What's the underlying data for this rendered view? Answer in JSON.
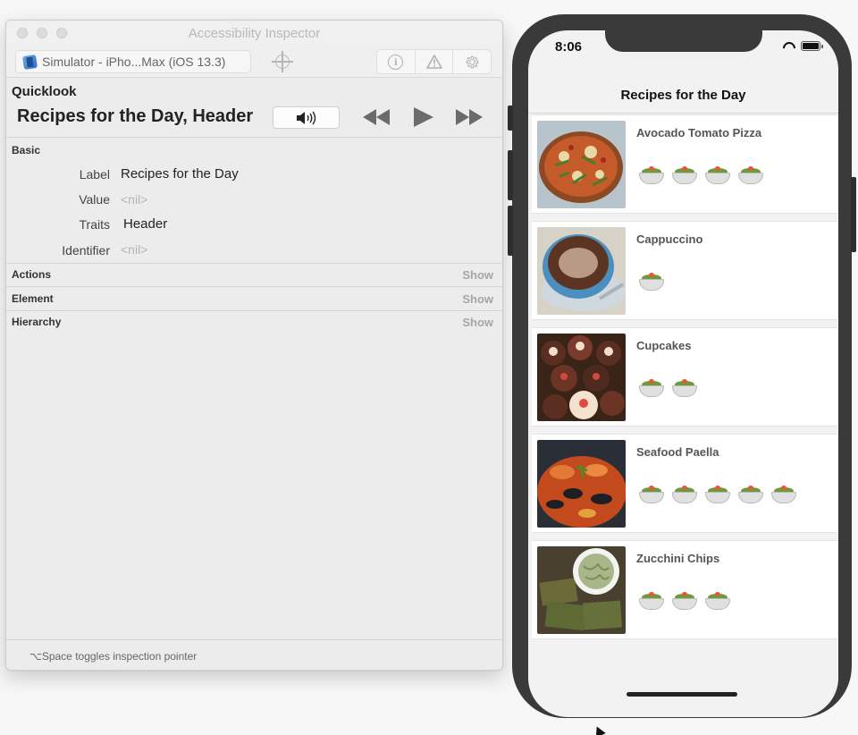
{
  "inspector": {
    "window_title": "Accessibility Inspector",
    "target": "Simulator - iPho...Max (iOS 13.3)",
    "quicklook_title": "Quicklook",
    "quicklook_text": "Recipes for the Day, Header",
    "basic_title": "Basic",
    "properties": [
      {
        "key": "Label",
        "value": "Recipes for the Day",
        "nil": false
      },
      {
        "key": "Value",
        "value": "<nil>",
        "nil": true
      },
      {
        "key": "Traits",
        "value": "Header",
        "nil": false
      },
      {
        "key": "Identifier",
        "value": "<nil>",
        "nil": true
      }
    ],
    "sections": [
      {
        "title": "Actions",
        "action": "Show"
      },
      {
        "title": "Element",
        "action": "Show"
      },
      {
        "title": "Hierarchy",
        "action": "Show"
      }
    ],
    "footer": "⌥Space toggles inspection pointer",
    "icons": {
      "target_icon": "simulator-icon",
      "point_icon": "crosshair-icon",
      "info_icon": "info-icon",
      "audit_icon": "warning-icon",
      "settings_icon": "gear-icon",
      "speak_icon": "speaker-icon",
      "prev_icon": "rewind-icon",
      "play_icon": "play-icon",
      "next_icon": "fast-forward-icon"
    }
  },
  "phone": {
    "time": "8:06",
    "nav_title": "Recipes for the Day",
    "recipes": [
      {
        "name": "Avocado Tomato Pizza",
        "rating": 4
      },
      {
        "name": "Cappuccino",
        "rating": 1
      },
      {
        "name": "Cupcakes",
        "rating": 2
      },
      {
        "name": "Seafood Paella",
        "rating": 5
      },
      {
        "name": "Zucchini Chips",
        "rating": 3
      }
    ]
  }
}
